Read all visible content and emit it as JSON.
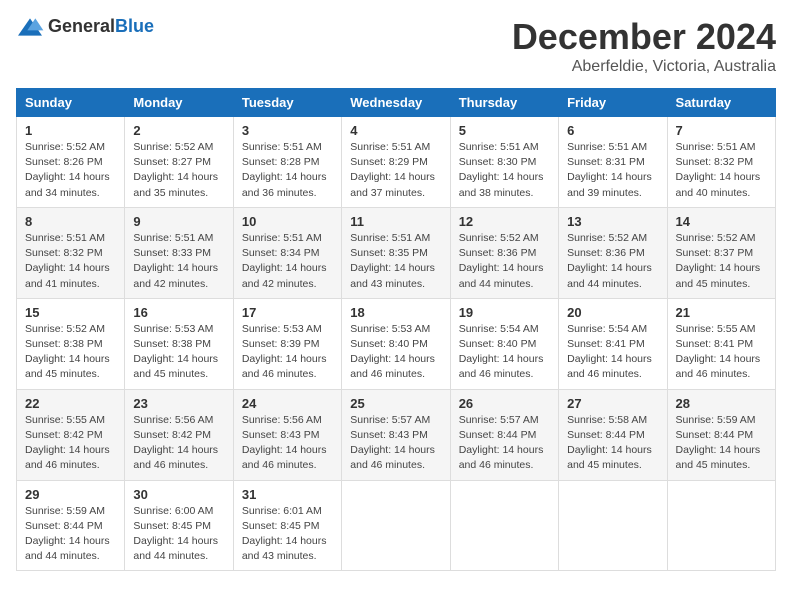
{
  "header": {
    "logo_general": "General",
    "logo_blue": "Blue",
    "month_title": "December 2024",
    "location": "Aberfeldie, Victoria, Australia"
  },
  "weekdays": [
    "Sunday",
    "Monday",
    "Tuesday",
    "Wednesday",
    "Thursday",
    "Friday",
    "Saturday"
  ],
  "weeks": [
    [
      {
        "day": "1",
        "sunrise": "5:52 AM",
        "sunset": "8:26 PM",
        "daylight": "14 hours and 34 minutes."
      },
      {
        "day": "2",
        "sunrise": "5:52 AM",
        "sunset": "8:27 PM",
        "daylight": "14 hours and 35 minutes."
      },
      {
        "day": "3",
        "sunrise": "5:51 AM",
        "sunset": "8:28 PM",
        "daylight": "14 hours and 36 minutes."
      },
      {
        "day": "4",
        "sunrise": "5:51 AM",
        "sunset": "8:29 PM",
        "daylight": "14 hours and 37 minutes."
      },
      {
        "day": "5",
        "sunrise": "5:51 AM",
        "sunset": "8:30 PM",
        "daylight": "14 hours and 38 minutes."
      },
      {
        "day": "6",
        "sunrise": "5:51 AM",
        "sunset": "8:31 PM",
        "daylight": "14 hours and 39 minutes."
      },
      {
        "day": "7",
        "sunrise": "5:51 AM",
        "sunset": "8:32 PM",
        "daylight": "14 hours and 40 minutes."
      }
    ],
    [
      {
        "day": "8",
        "sunrise": "5:51 AM",
        "sunset": "8:32 PM",
        "daylight": "14 hours and 41 minutes."
      },
      {
        "day": "9",
        "sunrise": "5:51 AM",
        "sunset": "8:33 PM",
        "daylight": "14 hours and 42 minutes."
      },
      {
        "day": "10",
        "sunrise": "5:51 AM",
        "sunset": "8:34 PM",
        "daylight": "14 hours and 42 minutes."
      },
      {
        "day": "11",
        "sunrise": "5:51 AM",
        "sunset": "8:35 PM",
        "daylight": "14 hours and 43 minutes."
      },
      {
        "day": "12",
        "sunrise": "5:52 AM",
        "sunset": "8:36 PM",
        "daylight": "14 hours and 44 minutes."
      },
      {
        "day": "13",
        "sunrise": "5:52 AM",
        "sunset": "8:36 PM",
        "daylight": "14 hours and 44 minutes."
      },
      {
        "day": "14",
        "sunrise": "5:52 AM",
        "sunset": "8:37 PM",
        "daylight": "14 hours and 45 minutes."
      }
    ],
    [
      {
        "day": "15",
        "sunrise": "5:52 AM",
        "sunset": "8:38 PM",
        "daylight": "14 hours and 45 minutes."
      },
      {
        "day": "16",
        "sunrise": "5:53 AM",
        "sunset": "8:38 PM",
        "daylight": "14 hours and 45 minutes."
      },
      {
        "day": "17",
        "sunrise": "5:53 AM",
        "sunset": "8:39 PM",
        "daylight": "14 hours and 46 minutes."
      },
      {
        "day": "18",
        "sunrise": "5:53 AM",
        "sunset": "8:40 PM",
        "daylight": "14 hours and 46 minutes."
      },
      {
        "day": "19",
        "sunrise": "5:54 AM",
        "sunset": "8:40 PM",
        "daylight": "14 hours and 46 minutes."
      },
      {
        "day": "20",
        "sunrise": "5:54 AM",
        "sunset": "8:41 PM",
        "daylight": "14 hours and 46 minutes."
      },
      {
        "day": "21",
        "sunrise": "5:55 AM",
        "sunset": "8:41 PM",
        "daylight": "14 hours and 46 minutes."
      }
    ],
    [
      {
        "day": "22",
        "sunrise": "5:55 AM",
        "sunset": "8:42 PM",
        "daylight": "14 hours and 46 minutes."
      },
      {
        "day": "23",
        "sunrise": "5:56 AM",
        "sunset": "8:42 PM",
        "daylight": "14 hours and 46 minutes."
      },
      {
        "day": "24",
        "sunrise": "5:56 AM",
        "sunset": "8:43 PM",
        "daylight": "14 hours and 46 minutes."
      },
      {
        "day": "25",
        "sunrise": "5:57 AM",
        "sunset": "8:43 PM",
        "daylight": "14 hours and 46 minutes."
      },
      {
        "day": "26",
        "sunrise": "5:57 AM",
        "sunset": "8:44 PM",
        "daylight": "14 hours and 46 minutes."
      },
      {
        "day": "27",
        "sunrise": "5:58 AM",
        "sunset": "8:44 PM",
        "daylight": "14 hours and 45 minutes."
      },
      {
        "day": "28",
        "sunrise": "5:59 AM",
        "sunset": "8:44 PM",
        "daylight": "14 hours and 45 minutes."
      }
    ],
    [
      {
        "day": "29",
        "sunrise": "5:59 AM",
        "sunset": "8:44 PM",
        "daylight": "14 hours and 44 minutes."
      },
      {
        "day": "30",
        "sunrise": "6:00 AM",
        "sunset": "8:45 PM",
        "daylight": "14 hours and 44 minutes."
      },
      {
        "day": "31",
        "sunrise": "6:01 AM",
        "sunset": "8:45 PM",
        "daylight": "14 hours and 43 minutes."
      },
      null,
      null,
      null,
      null
    ]
  ]
}
